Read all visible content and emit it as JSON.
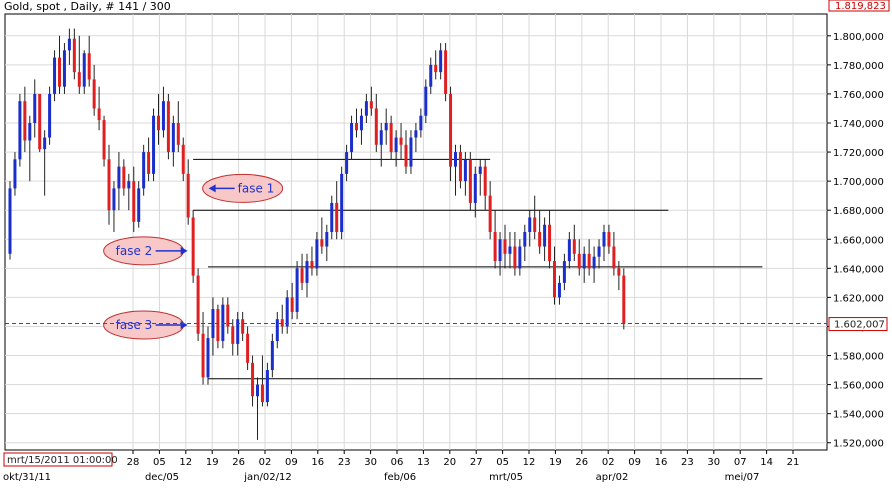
{
  "header": {
    "title": "Gold, spot , Daily, # 141 / 300"
  },
  "top_right_box": "1.819,823",
  "current_price_box": "1.602,007",
  "crosshair_date_box": "mrt/15/2011 01:00:00",
  "colors": {
    "bull": "#1a2ecc",
    "bear": "#e02020",
    "grid": "#d9d9d9",
    "line": "#000000",
    "dashed": "#3344cc",
    "ellipse_fill": "#f8c8c8",
    "ellipse_stroke": "#c03030"
  },
  "chart_data": {
    "type": "candlestick",
    "title": "Gold, spot , Daily, # 141 / 300",
    "ylim": [
      1515,
      1815
    ],
    "y_ticks": [
      "1.520,000",
      "1.540,000",
      "1.560,000",
      "1.580,000",
      "1.600,000",
      "1.620,000",
      "1.640,000",
      "1.660,000",
      "1.680,000",
      "1.700,000",
      "1.720,000",
      "1.740,000",
      "1.760,000",
      "1.780,000",
      "1.800,000"
    ],
    "y_tick_values": [
      1520,
      1540,
      1560,
      1580,
      1600,
      1620,
      1640,
      1660,
      1680,
      1700,
      1720,
      1740,
      1760,
      1780,
      1800
    ],
    "x_day_labels": [
      "28",
      "05",
      "12",
      "19",
      "26",
      "02",
      "09",
      "16",
      "23",
      "30",
      "06",
      "13",
      "20",
      "27",
      "05",
      "12",
      "19",
      "26",
      "02",
      "09",
      "16",
      "23",
      "30",
      "07",
      "14",
      "21"
    ],
    "x_month_labels": [
      "okt/31/11",
      "dec/05",
      "jan/02/12",
      "feb/06",
      "mrt/05",
      "apr/02",
      "mei/07"
    ],
    "current_price": 1602.007,
    "grid": true,
    "candles_ohlc": [
      [
        1650,
        1700,
        1646,
        1695
      ],
      [
        1695,
        1720,
        1690,
        1715
      ],
      [
        1715,
        1760,
        1710,
        1755
      ],
      [
        1755,
        1765,
        1720,
        1728
      ],
      [
        1728,
        1745,
        1700,
        1740
      ],
      [
        1740,
        1770,
        1730,
        1760
      ],
      [
        1760,
        1760,
        1720,
        1722
      ],
      [
        1722,
        1735,
        1690,
        1730
      ],
      [
        1730,
        1765,
        1725,
        1760
      ],
      [
        1760,
        1790,
        1755,
        1785
      ],
      [
        1785,
        1800,
        1760,
        1765
      ],
      [
        1765,
        1795,
        1760,
        1790
      ],
      [
        1790,
        1805,
        1780,
        1798
      ],
      [
        1798,
        1805,
        1770,
        1775
      ],
      [
        1775,
        1800,
        1760,
        1765
      ],
      [
        1765,
        1790,
        1760,
        1788
      ],
      [
        1788,
        1800,
        1765,
        1770
      ],
      [
        1770,
        1780,
        1745,
        1750
      ],
      [
        1750,
        1765,
        1735,
        1742
      ],
      [
        1742,
        1745,
        1710,
        1715
      ],
      [
        1715,
        1725,
        1670,
        1680
      ],
      [
        1680,
        1700,
        1665,
        1695
      ],
      [
        1695,
        1720,
        1680,
        1710
      ],
      [
        1710,
        1715,
        1690,
        1695
      ],
      [
        1695,
        1705,
        1680,
        1700
      ],
      [
        1700,
        1710,
        1665,
        1672
      ],
      [
        1672,
        1700,
        1668,
        1695
      ],
      [
        1695,
        1725,
        1690,
        1720
      ],
      [
        1720,
        1730,
        1700,
        1705
      ],
      [
        1705,
        1750,
        1700,
        1745
      ],
      [
        1745,
        1760,
        1725,
        1735
      ],
      [
        1735,
        1765,
        1730,
        1755
      ],
      [
        1755,
        1760,
        1715,
        1720
      ],
      [
        1720,
        1745,
        1710,
        1740
      ],
      [
        1740,
        1755,
        1720,
        1725
      ],
      [
        1725,
        1730,
        1700,
        1705
      ],
      [
        1705,
        1715,
        1670,
        1675
      ],
      [
        1675,
        1680,
        1630,
        1635
      ],
      [
        1635,
        1640,
        1590,
        1595
      ],
      [
        1595,
        1610,
        1560,
        1565
      ],
      [
        1565,
        1600,
        1560,
        1592
      ],
      [
        1592,
        1620,
        1580,
        1612
      ],
      [
        1612,
        1615,
        1585,
        1590
      ],
      [
        1590,
        1620,
        1585,
        1615
      ],
      [
        1615,
        1620,
        1595,
        1600
      ],
      [
        1600,
        1605,
        1580,
        1588
      ],
      [
        1588,
        1610,
        1580,
        1605
      ],
      [
        1605,
        1610,
        1590,
        1595
      ],
      [
        1595,
        1600,
        1570,
        1575
      ],
      [
        1575,
        1580,
        1545,
        1552
      ],
      [
        1552,
        1565,
        1522,
        1560
      ],
      [
        1560,
        1580,
        1545,
        1548
      ],
      [
        1548,
        1575,
        1545,
        1570
      ],
      [
        1570,
        1595,
        1565,
        1590
      ],
      [
        1590,
        1610,
        1585,
        1605
      ],
      [
        1605,
        1615,
        1595,
        1600
      ],
      [
        1600,
        1625,
        1595,
        1620
      ],
      [
        1620,
        1630,
        1605,
        1610
      ],
      [
        1610,
        1645,
        1605,
        1640
      ],
      [
        1640,
        1650,
        1625,
        1630
      ],
      [
        1630,
        1650,
        1620,
        1645
      ],
      [
        1645,
        1655,
        1635,
        1640
      ],
      [
        1640,
        1665,
        1635,
        1660
      ],
      [
        1660,
        1675,
        1650,
        1655
      ],
      [
        1655,
        1670,
        1645,
        1665
      ],
      [
        1665,
        1690,
        1660,
        1685
      ],
      [
        1685,
        1700,
        1660,
        1665
      ],
      [
        1665,
        1710,
        1660,
        1705
      ],
      [
        1705,
        1725,
        1700,
        1720
      ],
      [
        1720,
        1745,
        1715,
        1740
      ],
      [
        1740,
        1750,
        1730,
        1735
      ],
      [
        1735,
        1750,
        1725,
        1745
      ],
      [
        1745,
        1760,
        1740,
        1755
      ],
      [
        1755,
        1765,
        1745,
        1750
      ],
      [
        1750,
        1760,
        1720,
        1725
      ],
      [
        1725,
        1740,
        1710,
        1735
      ],
      [
        1735,
        1750,
        1725,
        1740
      ],
      [
        1740,
        1745,
        1715,
        1720
      ],
      [
        1720,
        1735,
        1710,
        1730
      ],
      [
        1730,
        1740,
        1715,
        1725
      ],
      [
        1725,
        1735,
        1705,
        1710
      ],
      [
        1710,
        1735,
        1705,
        1730
      ],
      [
        1730,
        1740,
        1720,
        1735
      ],
      [
        1735,
        1750,
        1730,
        1745
      ],
      [
        1745,
        1770,
        1740,
        1765
      ],
      [
        1765,
        1785,
        1760,
        1780
      ],
      [
        1780,
        1790,
        1770,
        1775
      ],
      [
        1775,
        1795,
        1770,
        1790
      ],
      [
        1790,
        1795,
        1755,
        1760
      ],
      [
        1760,
        1765,
        1700,
        1710
      ],
      [
        1710,
        1725,
        1690,
        1720
      ],
      [
        1720,
        1725,
        1695,
        1700
      ],
      [
        1700,
        1720,
        1690,
        1715
      ],
      [
        1715,
        1720,
        1680,
        1685
      ],
      [
        1685,
        1710,
        1675,
        1705
      ],
      [
        1705,
        1715,
        1690,
        1710
      ],
      [
        1710,
        1715,
        1680,
        1690
      ],
      [
        1690,
        1700,
        1660,
        1665
      ],
      [
        1665,
        1680,
        1640,
        1645
      ],
      [
        1645,
        1665,
        1635,
        1660
      ],
      [
        1660,
        1670,
        1640,
        1650
      ],
      [
        1650,
        1665,
        1640,
        1655
      ],
      [
        1655,
        1665,
        1635,
        1640
      ],
      [
        1640,
        1660,
        1635,
        1655
      ],
      [
        1655,
        1670,
        1645,
        1665
      ],
      [
        1665,
        1680,
        1655,
        1675
      ],
      [
        1675,
        1690,
        1660,
        1665
      ],
      [
        1665,
        1680,
        1650,
        1655
      ],
      [
        1655,
        1675,
        1645,
        1670
      ],
      [
        1670,
        1680,
        1640,
        1645
      ],
      [
        1645,
        1655,
        1615,
        1620
      ],
      [
        1620,
        1635,
        1615,
        1630
      ],
      [
        1630,
        1650,
        1625,
        1645
      ],
      [
        1645,
        1665,
        1640,
        1660
      ],
      [
        1660,
        1670,
        1645,
        1650
      ],
      [
        1650,
        1660,
        1635,
        1640
      ],
      [
        1640,
        1655,
        1630,
        1650
      ],
      [
        1650,
        1660,
        1635,
        1640
      ],
      [
        1640,
        1655,
        1630,
        1648
      ],
      [
        1648,
        1660,
        1640,
        1655
      ],
      [
        1655,
        1670,
        1645,
        1665
      ],
      [
        1665,
        1670,
        1650,
        1655
      ],
      [
        1655,
        1665,
        1635,
        1640
      ],
      [
        1640,
        1645,
        1625,
        1635
      ],
      [
        1635,
        1640,
        1598,
        1602
      ]
    ],
    "horizontal_lines": [
      {
        "from_index": 37,
        "to_index": 97,
        "price": 1715
      },
      {
        "from_index": 37,
        "to_index": 133,
        "price": 1680
      },
      {
        "from_index": 40,
        "to_index": 152,
        "price": 1641
      },
      {
        "from_index": 40,
        "to_index": 152,
        "price": 1564
      }
    ],
    "annotations": [
      {
        "label": "fase 1",
        "price": 1695,
        "index_center": 47,
        "arrow": "left"
      },
      {
        "label": "fase 2",
        "price": 1652,
        "index_center": 27,
        "arrow": "right"
      },
      {
        "label": "fase 3",
        "price": 1601,
        "index_center": 27,
        "arrow": "right"
      }
    ]
  }
}
